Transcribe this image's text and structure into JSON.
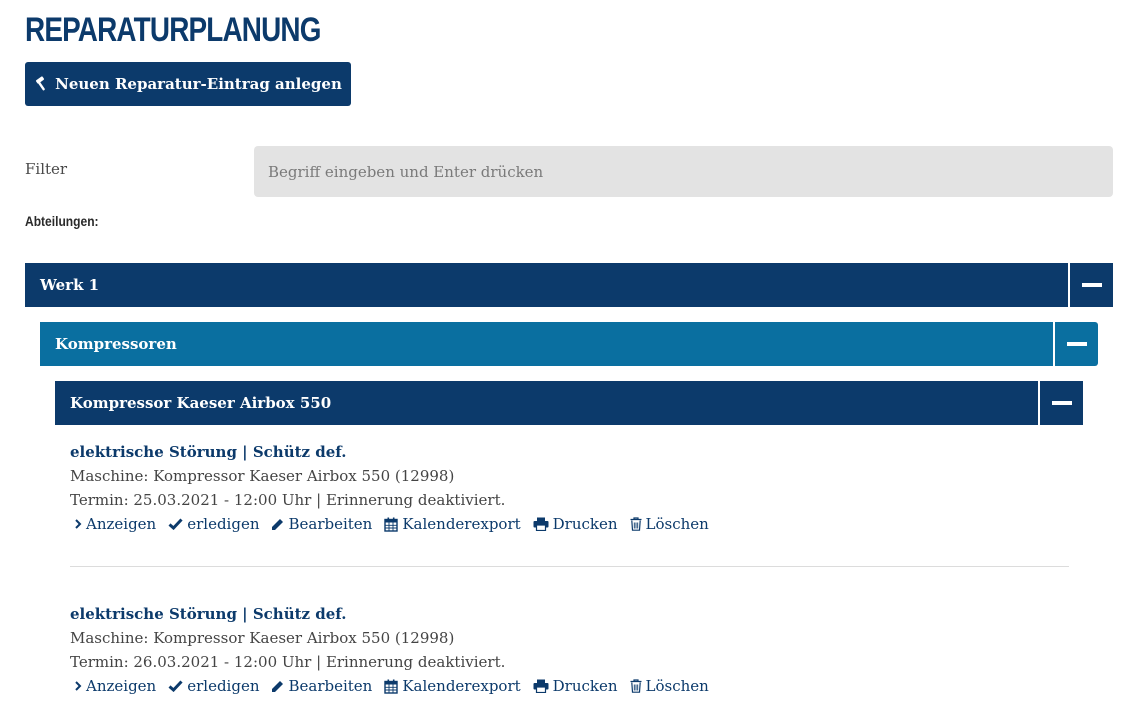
{
  "page": {
    "title": "REPARATURPLANUNG",
    "new_button_label": "Neuen Reparatur-Eintrag anlegen"
  },
  "filter": {
    "label": "Filter",
    "placeholder": "Begriff eingeben und Enter drücken",
    "value": ""
  },
  "departments_label": "Abteilungen:",
  "groups": {
    "werk": "Werk 1",
    "category": "Kompressoren",
    "machine": "Kompressor Kaeser Airbox 550"
  },
  "entries": [
    {
      "title": "elektrische Störung | Schütz def.",
      "machine": "Maschine: Kompressor Kaeser Airbox 550 (12998)",
      "termin": "Termin: 25.03.2021 - 12:00 Uhr | Erinnerung deaktiviert."
    },
    {
      "title": "elektrische Störung | Schütz def.",
      "machine": "Maschine: Kompressor Kaeser Airbox 550 (12998)",
      "termin": "Termin: 26.03.2021 - 12:00 Uhr | Erinnerung deaktiviert."
    }
  ],
  "actions": {
    "show": "Anzeigen",
    "done": "erledigen",
    "edit": "Bearbeiten",
    "calendar": "Kalenderexport",
    "print": "Drucken",
    "delete": "Löschen"
  },
  "icons": {
    "new_button": "hammer-icon",
    "show": "chevron-right-icon",
    "done": "check-icon",
    "edit": "pencil-icon",
    "calendar": "calendar-icon",
    "print": "printer-icon",
    "delete": "trash-icon",
    "collapse": "minus-icon"
  },
  "colors": {
    "primary": "#0c3a6b",
    "secondary": "#0a6fa0",
    "input_bg": "#e3e3e3"
  }
}
